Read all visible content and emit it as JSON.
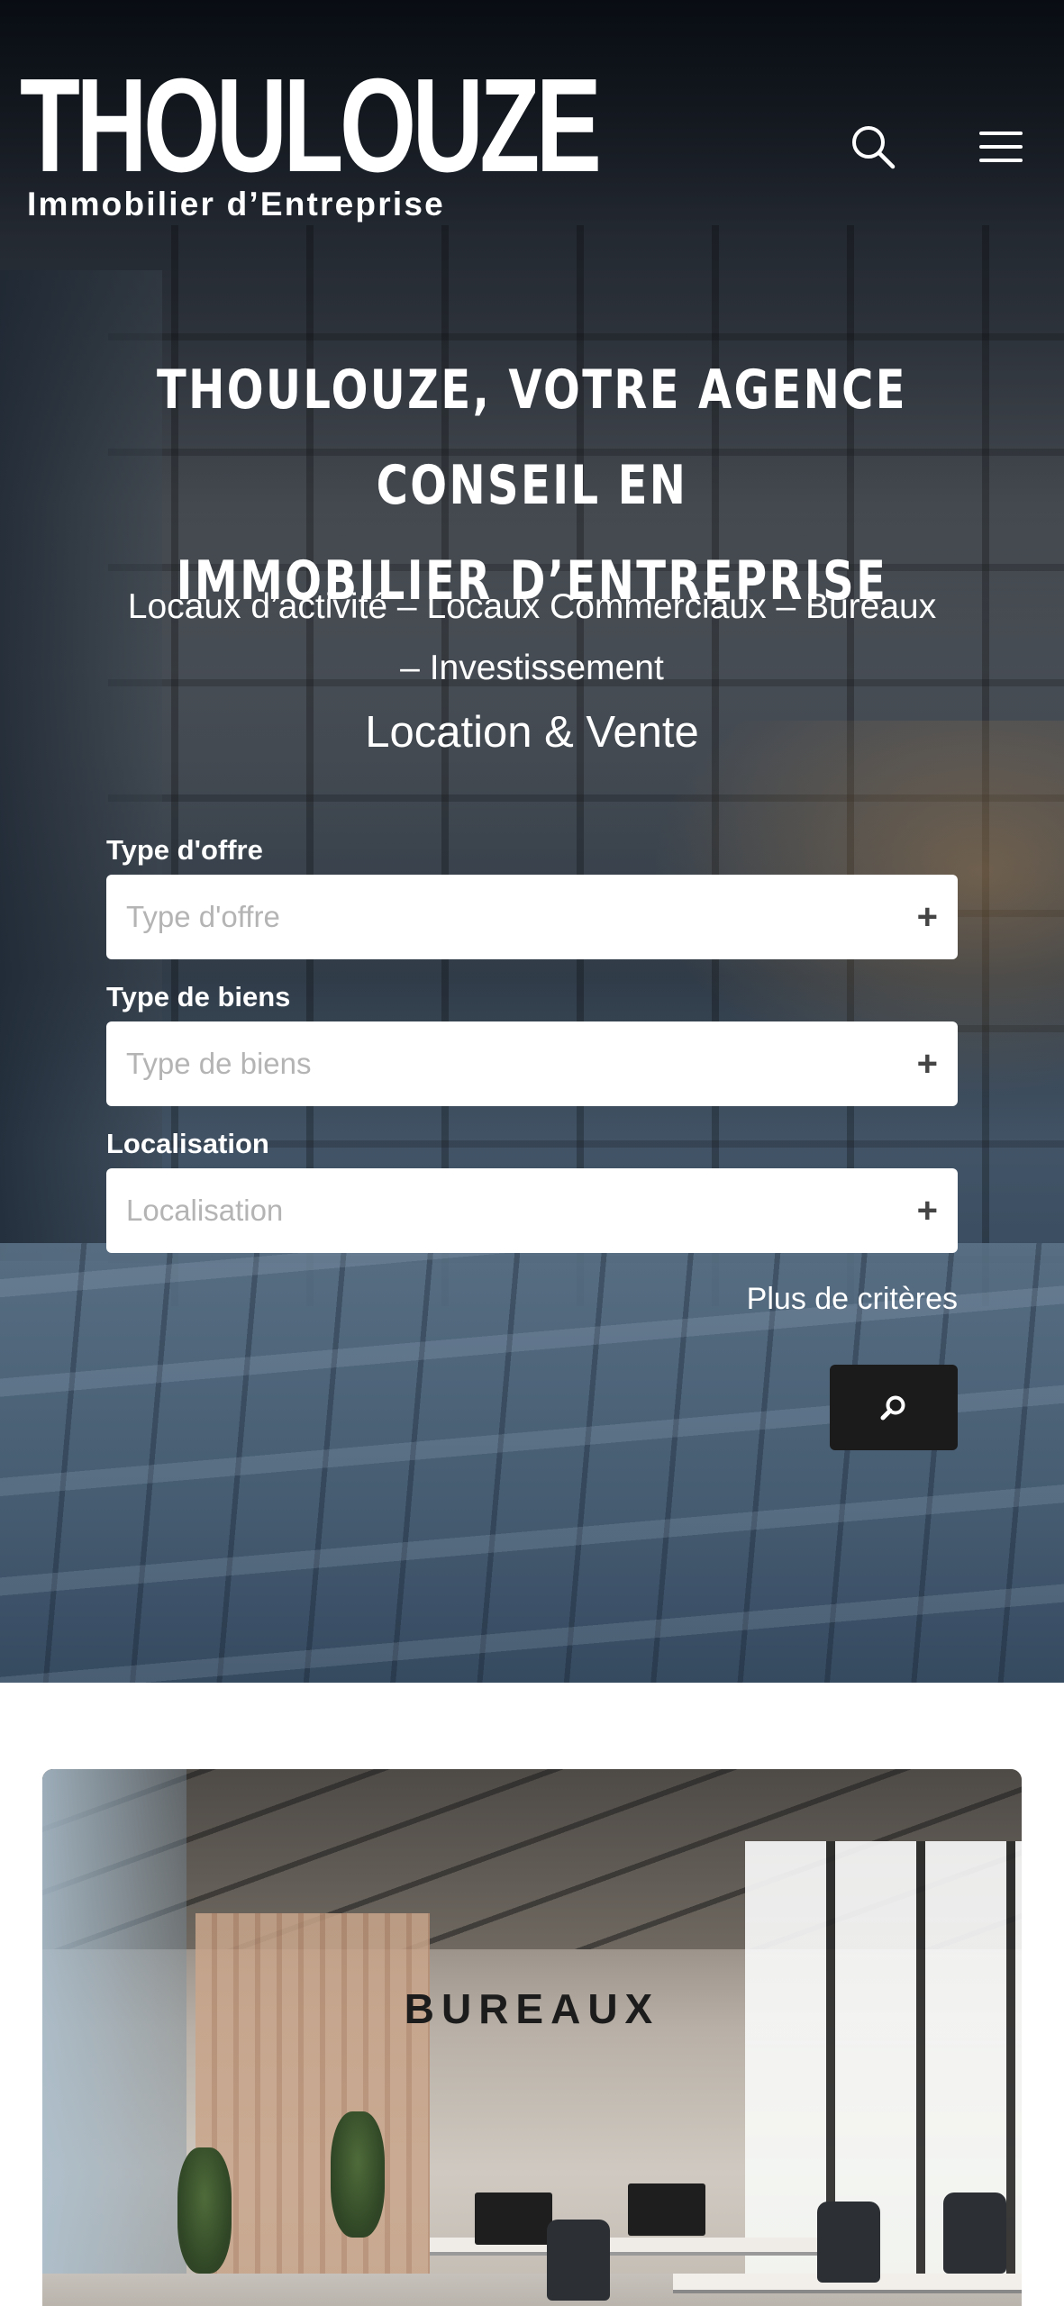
{
  "header": {
    "logo_main": "THOULOUZE",
    "logo_sub": "Immobilier d’Entreprise",
    "search_icon": "search-icon",
    "menu_icon": "hamburger-menu-icon"
  },
  "hero": {
    "title_line1": "THOULOUZE, VOTRE AGENCE CONSEIL EN",
    "title_line2": "IMMOBILIER D’ENTREPRISE",
    "subtitle_line1": "Locaux d’activité – Locaux Commerciaux – Bureaux",
    "subtitle_line2": "– Investissement",
    "tagline": "Location & Vente"
  },
  "search_form": {
    "offer_type": {
      "label": "Type d'offre",
      "placeholder": "Type d'offre",
      "expand_icon": "plus-icon"
    },
    "property_type": {
      "label": "Type de biens",
      "placeholder": "Type de biens",
      "expand_icon": "plus-icon"
    },
    "location": {
      "label": "Localisation",
      "placeholder": "Localisation",
      "expand_icon": "plus-icon"
    },
    "more_criteria": "Plus de critères",
    "submit_icon": "search-icon"
  },
  "categories": [
    {
      "title": "BUREAUX"
    }
  ],
  "colors": {
    "text_on_dark": "#ffffff",
    "button_dark": "#1b1b1b",
    "placeholder": "#b4b4b4",
    "page_background": "#ffffff"
  }
}
